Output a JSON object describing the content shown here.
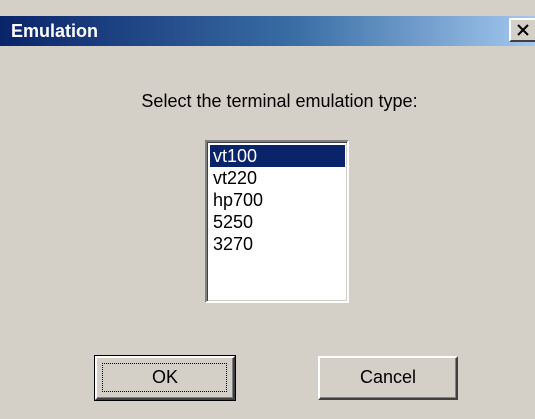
{
  "window": {
    "title": "Emulation",
    "colors": {
      "title_gradient_start": "#0a246a",
      "title_gradient_end": "#a6caf0",
      "face": "#d4d0c8",
      "selection": "#0a246a"
    }
  },
  "dialog": {
    "prompt": "Select the terminal emulation type:",
    "emulation_types": [
      {
        "label": "vt100",
        "selected": true
      },
      {
        "label": "vt220",
        "selected": false
      },
      {
        "label": "hp700",
        "selected": false
      },
      {
        "label": "5250",
        "selected": false
      },
      {
        "label": "3270",
        "selected": false
      }
    ]
  },
  "buttons": {
    "ok_label": "OK",
    "cancel_label": "Cancel"
  },
  "icons": {
    "close": "close-icon"
  }
}
